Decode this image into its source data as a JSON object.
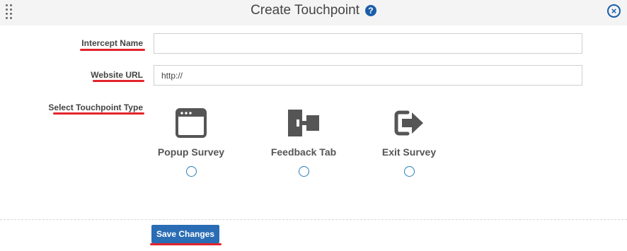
{
  "header": {
    "title": "Create Touchpoint",
    "help_glyph": "?",
    "close_glyph": "×"
  },
  "form": {
    "intercept_name": {
      "label": "Intercept Name",
      "value": ""
    },
    "website_url": {
      "label": "Website URL",
      "value": "http://"
    },
    "touchpoint_type": {
      "label": "Select Touchpoint Type",
      "options": [
        {
          "label": "Popup Survey",
          "icon": "browser-window-icon",
          "selected": false
        },
        {
          "label": "Feedback Tab",
          "icon": "feedback-tab-icon",
          "selected": false
        },
        {
          "label": "Exit Survey",
          "icon": "exit-arrow-icon",
          "selected": false
        }
      ]
    }
  },
  "actions": {
    "save_label": "Save Changes"
  },
  "colors": {
    "accent": "#1a5ea8",
    "button": "#2a6db5",
    "annotation_underline": "#e3242b",
    "icon": "#555555"
  }
}
